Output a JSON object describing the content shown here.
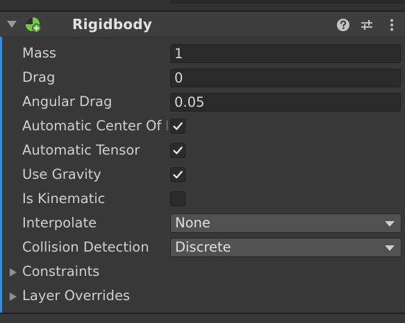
{
  "component": {
    "title": "Rigidbody",
    "icon": "rigidbody-physics-icon",
    "header_buttons": {
      "help_icon": "question-mark-icon",
      "preset_icon": "sliders-preset-icon",
      "menu_icon": "vertical-ellipsis-icon"
    }
  },
  "fields": {
    "mass": {
      "label": "Mass",
      "value": "1"
    },
    "drag": {
      "label": "Drag",
      "value": "0"
    },
    "angular_drag": {
      "label": "Angular Drag",
      "value": "0.05"
    },
    "automatic_center_of_mass": {
      "label": "Automatic Center Of Mass",
      "checked": true
    },
    "automatic_tensor": {
      "label": "Automatic Tensor",
      "checked": true
    },
    "use_gravity": {
      "label": "Use Gravity",
      "checked": true
    },
    "is_kinematic": {
      "label": "Is Kinematic",
      "checked": false
    },
    "interpolate": {
      "label": "Interpolate",
      "value": "None"
    },
    "collision_detection": {
      "label": "Collision Detection",
      "value": "Discrete"
    }
  },
  "foldouts": {
    "constraints": {
      "label": "Constraints",
      "expanded": false
    },
    "layer_overrides": {
      "label": "Layer Overrides",
      "expanded": false
    }
  },
  "colors": {
    "background": "#383838",
    "header": "#3e3e3e",
    "accent": "#3b8ad6",
    "icon_green": "#6bd136"
  }
}
